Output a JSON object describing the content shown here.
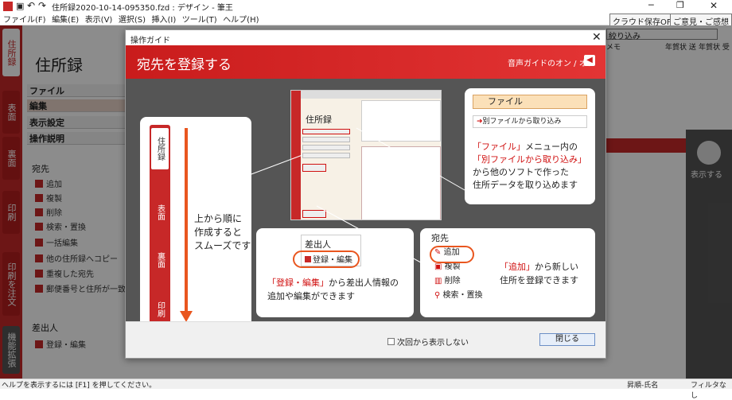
{
  "window": {
    "title": "住所録2020-10-14-095350.fzd : デザイン - 筆王",
    "menu": [
      "ファイル(F)",
      "編集(E)",
      "表示(V)",
      "選択(S)",
      "挿入(I)",
      "ツール(T)",
      "ヘルプ(H)"
    ],
    "cloud_save": "クラウド保存OFF",
    "feedback": "ご意見・ご感想"
  },
  "sidebar_tabs": [
    "住所録",
    "表面",
    "裏面",
    "印刷",
    "印刷を注文",
    "機能拡張"
  ],
  "left_panel": {
    "title": "住所録",
    "menus": [
      "ファイル",
      "編集",
      "表示設定",
      "操作説明"
    ],
    "section_atesaki": "宛先",
    "items": [
      "追加",
      "複製",
      "削除",
      "検索・置換",
      "一括編集",
      "他の住所録へコピー",
      "重複した宛先",
      "郵便番号と住所が一致"
    ],
    "section_sashidashi": "差出人",
    "sashidashi_item": "登録・編集"
  },
  "right_panel": {
    "filter_label": "絞り込み",
    "columns": [
      "メモ",
      "年賀状 送",
      "年賀状 受"
    ],
    "show_label": "表示する"
  },
  "status": {
    "help": "ヘルプを表示するには [F1] を押してください。",
    "sort": "昇順-氏名",
    "filter": "フィルタなし"
  },
  "dialog": {
    "title": "操作ガイド",
    "banner_title": "宛先を登録する",
    "voice_toggle": "音声ガイドのオン / オフ",
    "card_order": {
      "tabs": [
        "住所録",
        "表面",
        "裏面",
        "印刷"
      ],
      "text": [
        "上から順に",
        "作成すると",
        "スムーズです"
      ]
    },
    "card_file": {
      "menu_file": "ファイル",
      "import_item": "別ファイルから取り込み",
      "line1_red": "「ファイル」",
      "line1_rest": "メニュー内の",
      "line2_red": "「別ファイルから取り込み」",
      "line3": "から他のソフトで作った",
      "line4": "住所データを取り込めます"
    },
    "card_sender": {
      "header": "差出人",
      "button": "登録・編集",
      "line1_red": "「登録・編集」",
      "line1_rest": "から差出人情報の",
      "line2": "追加や編集ができます"
    },
    "card_add": {
      "header": "宛先",
      "items": [
        "追加",
        "複製",
        "削除",
        "検索・置換"
      ],
      "line1_red": "「追加」",
      "line1_rest": "から新しい",
      "line2": "住所を登録できます"
    },
    "mini_screen_title": "住所録",
    "dont_show_again": "次回から表示しない",
    "close_button": "閉じる"
  },
  "colors": {
    "accent_red": "#c72828",
    "arrow_orange": "#e9561f",
    "highlight_red": "#d01010"
  }
}
